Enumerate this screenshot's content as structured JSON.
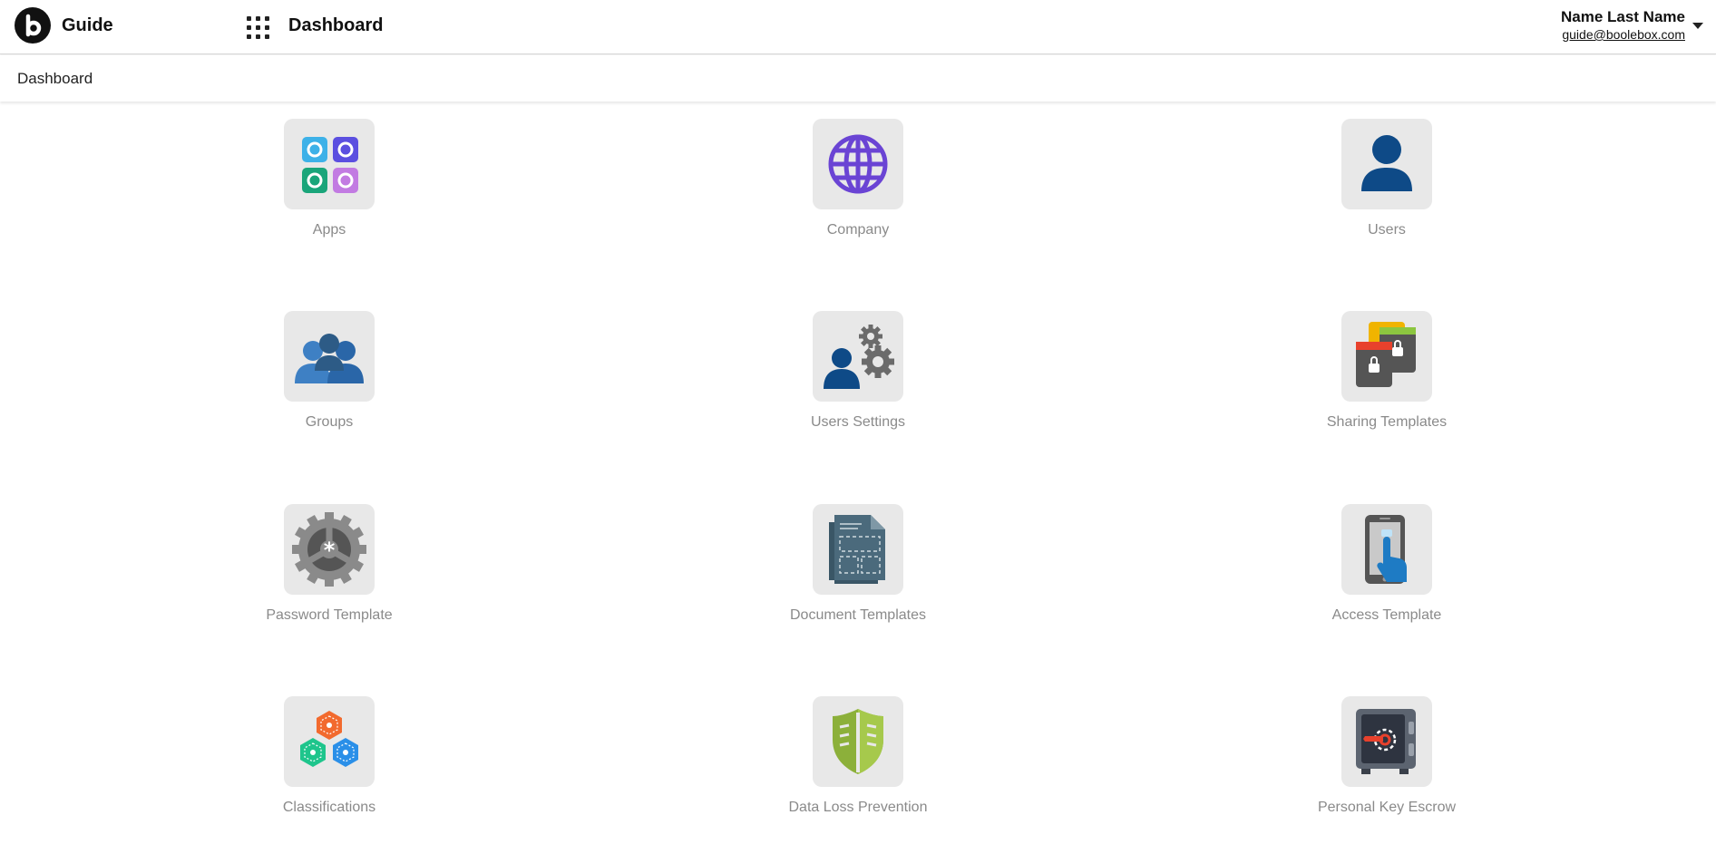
{
  "header": {
    "app_name": "Guide",
    "page_title": "Dashboard",
    "user_name": "Name Last Name",
    "user_email": "guide@boolebox.com"
  },
  "breadcrumb": "Dashboard",
  "tiles": [
    {
      "label": "Apps",
      "icon": "apps-icon"
    },
    {
      "label": "Company",
      "icon": "globe-icon"
    },
    {
      "label": "Users",
      "icon": "user-icon"
    },
    {
      "label": "Groups",
      "icon": "group-icon"
    },
    {
      "label": "Users Settings",
      "icon": "user-settings-icon"
    },
    {
      "label": "Sharing Templates",
      "icon": "sharing-templates-icon"
    },
    {
      "label": "Password Template",
      "icon": "password-gear-icon"
    },
    {
      "label": "Document Templates",
      "icon": "document-templates-icon"
    },
    {
      "label": "Access Template",
      "icon": "touch-phone-icon"
    },
    {
      "label": "Classifications",
      "icon": "hexagons-icon"
    },
    {
      "label": "Data Loss Prevention",
      "icon": "shield-icon"
    },
    {
      "label": "Personal Key Escrow",
      "icon": "safe-icon"
    }
  ]
}
